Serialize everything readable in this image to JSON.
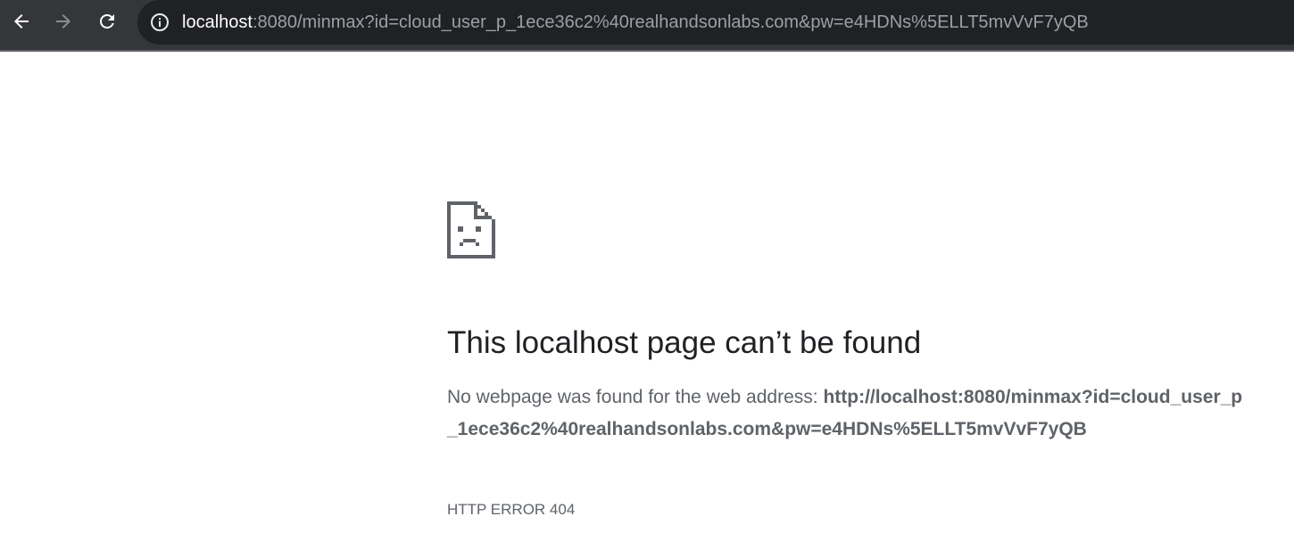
{
  "browser": {
    "url_host": "localhost",
    "url_rest": ":8080/minmax?id=cloud_user_p_1ece36c2%40realhandsonlabs.com&pw=e4HDNs%5ELLT5mvVvF7yQB",
    "icons": {
      "back": "arrow-left-icon",
      "forward": "arrow-right-icon",
      "reload": "reload-icon",
      "site_info": "info-circle-icon"
    }
  },
  "error_page": {
    "icon": "sad-document-icon",
    "title": "This localhost page can’t be found",
    "description_prefix": "No webpage was found for the web address: ",
    "description_url": "http://localhost:8080/minmax?id=cloud_user_p_1ece36c2%40realhandsonlabs.com&pw=e4HDNs%5ELLT5mvVvF7yQB",
    "error_code": "HTTP ERROR 404"
  },
  "colors": {
    "toolbar_bg": "#35363a",
    "omnibox_bg": "#202124",
    "title_text": "#202124",
    "body_text": "#5f6368"
  }
}
